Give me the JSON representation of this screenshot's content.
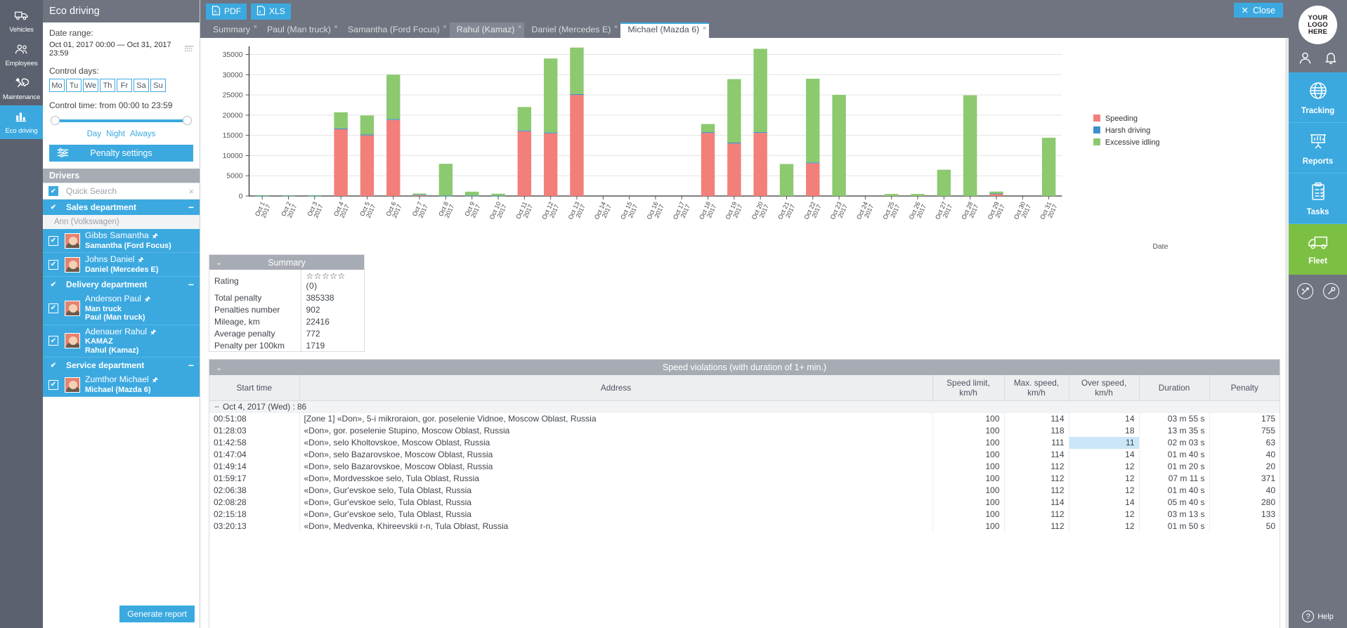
{
  "left_rail": {
    "items": [
      {
        "label": "Vehicles",
        "icon": "truck-icon",
        "active": false
      },
      {
        "label": "Employees",
        "icon": "employees-icon",
        "active": false
      },
      {
        "label": "Maintenance",
        "icon": "wrench-icon",
        "active": false
      },
      {
        "label": "Eco driving",
        "icon": "bar-chart-icon",
        "active": true
      }
    ]
  },
  "panel": {
    "title": "Eco driving",
    "date_range_label": "Date range:",
    "date_range_value": "Oct 01, 2017 00:00 — Oct 31, 2017 23:59",
    "control_days_label": "Control days:",
    "days": [
      "Mo",
      "Tu",
      "We",
      "Th",
      "Fr",
      "Sa",
      "Su"
    ],
    "control_time": "Control time: from 00:00 to 23:59",
    "presets": [
      "Day",
      "Night",
      "Always"
    ],
    "penalty_settings": "Penalty settings",
    "drivers_header": "Drivers",
    "quick_search": "Quick Search",
    "generate_report": "Generate report",
    "tree": [
      {
        "type": "department",
        "label": "Sales department"
      },
      {
        "type": "note",
        "label": "Ann (Volkswagen)"
      },
      {
        "type": "driver",
        "name": "Gibbs Samantha",
        "unit": "Samantha (Ford Focus)",
        "sub": ""
      },
      {
        "type": "driver",
        "name": "Johns Daniel",
        "unit": "Daniel (Mercedes E)",
        "sub": ""
      },
      {
        "type": "department",
        "label": "Delivery department"
      },
      {
        "type": "driver",
        "name": "Anderson Paul",
        "unit": "Paul (Man truck)",
        "sub": "Man truck"
      },
      {
        "type": "driver",
        "name": "Adenauer Rahul",
        "unit": "Rahul (Kamaz)",
        "sub": "KAMAZ"
      },
      {
        "type": "department",
        "label": "Service department"
      },
      {
        "type": "driver",
        "name": "Zumthor Michael",
        "unit": "Michael (Mazda 6)",
        "sub": ""
      }
    ]
  },
  "toolbar": {
    "pdf": "PDF",
    "xls": "XLS",
    "close": "Close"
  },
  "tabs": [
    {
      "label": "Summary",
      "active": false,
      "dim": false
    },
    {
      "label": "Paul (Man truck)",
      "active": false,
      "dim": false
    },
    {
      "label": "Samantha (Ford Focus)",
      "active": false,
      "dim": false
    },
    {
      "label": "Rahul (Kamaz)",
      "active": false,
      "dim": true
    },
    {
      "label": "Daniel (Mercedes E)",
      "active": false,
      "dim": false
    },
    {
      "label": "Michael (Mazda 6)",
      "active": true,
      "dim": false
    }
  ],
  "chart_data": {
    "type": "bar",
    "title": "",
    "xlabel": "Date",
    "ylabel": "",
    "ylim": [
      0,
      37000
    ],
    "yticks": [
      0,
      5000,
      10000,
      15000,
      20000,
      25000,
      30000,
      35000
    ],
    "grid": true,
    "legend_position": "right",
    "stacked": true,
    "categories": [
      "Oct 1, 2017",
      "Oct 2, 2017",
      "Oct 3, 2017",
      "Oct 4, 2017",
      "Oct 5, 2017",
      "Oct 6, 2017",
      "Oct 7, 2017",
      "Oct 8, 2017",
      "Oct 9, 2017",
      "Oct 10, 2017",
      "Oct 11, 2017",
      "Oct 12, 2017",
      "Oct 13, 2017",
      "Oct 14, 2017",
      "Oct 15, 2017",
      "Oct 16, 2017",
      "Oct 17, 2017",
      "Oct 18, 2017",
      "Oct 19, 2017",
      "Oct 20, 2017",
      "Oct 21, 2017",
      "Oct 22, 2017",
      "Oct 23, 2017",
      "Oct 24, 2017",
      "Oct 25, 2017",
      "Oct 26, 2017",
      "Oct 27, 2017",
      "Oct 28, 2017",
      "Oct 29, 2017",
      "Oct 30, 2017",
      "Oct 31, 2017"
    ],
    "series": [
      {
        "name": "Speeding",
        "color": "#f37f7a",
        "values": [
          0,
          0,
          0,
          16500,
          15000,
          18800,
          250,
          0,
          0,
          0,
          16000,
          15500,
          25000,
          0,
          0,
          0,
          0,
          15600,
          13000,
          15600,
          0,
          8100,
          0,
          0,
          0,
          0,
          0,
          0,
          500,
          0,
          0
        ]
      },
      {
        "name": "Harsh driving",
        "color": "#3c8fd0",
        "values": [
          60,
          60,
          60,
          200,
          200,
          200,
          60,
          60,
          60,
          60,
          200,
          200,
          200,
          0,
          0,
          0,
          0,
          200,
          200,
          200,
          0,
          200,
          0,
          0,
          0,
          0,
          0,
          0,
          100,
          0,
          0
        ]
      },
      {
        "name": "Excessive idling",
        "color": "#8cc96f",
        "values": [
          140,
          140,
          140,
          4000,
          4700,
          11000,
          300,
          7900,
          1000,
          500,
          5800,
          18300,
          11500,
          0,
          0,
          0,
          0,
          2000,
          15700,
          20600,
          7900,
          20700,
          25000,
          0,
          500,
          500,
          6500,
          24900,
          500,
          0,
          14400
        ]
      }
    ]
  },
  "summary": {
    "header": "Summary",
    "rows": [
      {
        "key": "Rating",
        "value": "☆☆☆☆☆ (0)"
      },
      {
        "key": "Total penalty",
        "value": "385338"
      },
      {
        "key": "Penalties number",
        "value": "902"
      },
      {
        "key": "Mileage, km",
        "value": "22416"
      },
      {
        "key": "Average penalty",
        "value": "772"
      },
      {
        "key": "Penalty per 100km",
        "value": "1719"
      }
    ]
  },
  "violations": {
    "header": "Speed violations (with duration of 1+ min.)",
    "columns": [
      "Start time",
      "Address",
      "Speed limit, km/h",
      "Max. speed, km/h",
      "Over speed, km/h",
      "Duration",
      "Penalty"
    ],
    "group_label": "Oct 4, 2017 (Wed) : 86",
    "rows": [
      {
        "start": "00:51:08",
        "address": "[Zone 1] «Don», 5-i mikroraion, gor. poselenie Vidnoe, Moscow Oblast, Russia",
        "limit": "100",
        "max": "114",
        "over": "14",
        "duration": "03 m 55 s",
        "penalty": "175",
        "highlight": false
      },
      {
        "start": "01:28:03",
        "address": "«Don», gor. poselenie Stupino, Moscow Oblast, Russia",
        "limit": "100",
        "max": "118",
        "over": "18",
        "duration": "13 m 35 s",
        "penalty": "755",
        "highlight": false
      },
      {
        "start": "01:42:58",
        "address": "«Don», selo Kholtovskoe, Moscow Oblast, Russia",
        "limit": "100",
        "max": "111",
        "over": "11",
        "duration": "02 m 03 s",
        "penalty": "63",
        "highlight": true
      },
      {
        "start": "01:47:04",
        "address": "«Don», selo Bazarovskoe, Moscow Oblast, Russia",
        "limit": "100",
        "max": "114",
        "over": "14",
        "duration": "01 m 40 s",
        "penalty": "40",
        "highlight": false
      },
      {
        "start": "01:49:14",
        "address": "«Don», selo Bazarovskoe, Moscow Oblast, Russia",
        "limit": "100",
        "max": "112",
        "over": "12",
        "duration": "01 m 20 s",
        "penalty": "20",
        "highlight": false
      },
      {
        "start": "01:59:17",
        "address": "«Don», Mordvesskoe selo, Tula Oblast, Russia",
        "limit": "100",
        "max": "112",
        "over": "12",
        "duration": "07 m 11 s",
        "penalty": "371",
        "highlight": false
      },
      {
        "start": "02:06:38",
        "address": "«Don», Gur'evskoe selo, Tula Oblast, Russia",
        "limit": "100",
        "max": "112",
        "over": "12",
        "duration": "01 m 40 s",
        "penalty": "40",
        "highlight": false
      },
      {
        "start": "02:08:28",
        "address": "«Don», Gur'evskoe selo, Tula Oblast, Russia",
        "limit": "100",
        "max": "114",
        "over": "14",
        "duration": "05 m 40 s",
        "penalty": "280",
        "highlight": false
      },
      {
        "start": "02:15:18",
        "address": "«Don», Gur'evskoe selo, Tula Oblast, Russia",
        "limit": "100",
        "max": "112",
        "over": "12",
        "duration": "03 m 13 s",
        "penalty": "133",
        "highlight": false
      },
      {
        "start": "03:20:13",
        "address": "«Don», Medvenka, Khireevskii r-n, Tula Oblast, Russia",
        "limit": "100",
        "max": "112",
        "over": "12",
        "duration": "01 m 50 s",
        "penalty": "50",
        "highlight": false
      }
    ]
  },
  "right_rail": {
    "logo": [
      "YOUR",
      "LOGO",
      "HERE"
    ],
    "nav": [
      {
        "label": "Tracking",
        "icon": "globe-icon",
        "color": "#3ba9e0"
      },
      {
        "label": "Reports",
        "icon": "presentation-chart-icon",
        "color": "#3ba9e0"
      },
      {
        "label": "Tasks",
        "icon": "clipboard-check-icon",
        "color": "#3ba9e0"
      },
      {
        "label": "Fleet",
        "icon": "truck-icon",
        "color": "#7cc043"
      }
    ],
    "help": "Help"
  },
  "colors": {
    "accent": "#3ba9e0",
    "green": "#7cc043",
    "speeding": "#f37f7a",
    "harsh": "#3c8fd0",
    "idling": "#8cc96f",
    "panel_gray": "#6f7480",
    "header_gray": "#a7abb4"
  }
}
